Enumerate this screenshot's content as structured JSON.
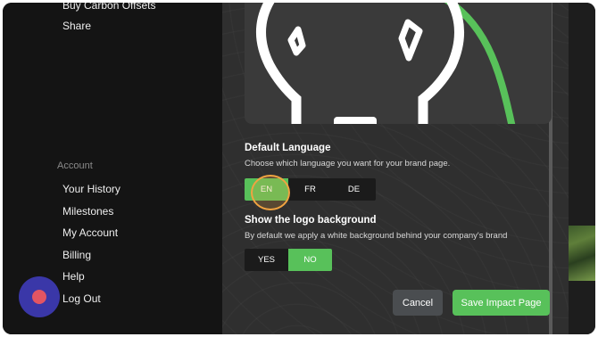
{
  "sidebar": {
    "top_items": [
      {
        "label": "Buy Carbon Offsets"
      },
      {
        "label": "Share"
      }
    ],
    "account_heading": "Account",
    "account_items": [
      {
        "label": "Your History"
      },
      {
        "label": "Milestones"
      },
      {
        "label": "My Account"
      },
      {
        "label": "Billing"
      },
      {
        "label": "Help"
      },
      {
        "label": "Log Out"
      }
    ]
  },
  "default_language": {
    "title": "Default Language",
    "description": "Choose which language you want for your brand page.",
    "options": [
      "EN",
      "FR",
      "DE"
    ],
    "selected": "EN"
  },
  "logo_background": {
    "title": "Show the logo background",
    "description": "By default we apply a white background behind your company's brand",
    "options": [
      "YES",
      "NO"
    ],
    "selected": "NO"
  },
  "actions": {
    "cancel_label": "Cancel",
    "save_label": "Save Impact Page"
  },
  "colors": {
    "accent": "#58c15a",
    "highlight": "#f0a341",
    "help_button": "#3a37a8"
  }
}
